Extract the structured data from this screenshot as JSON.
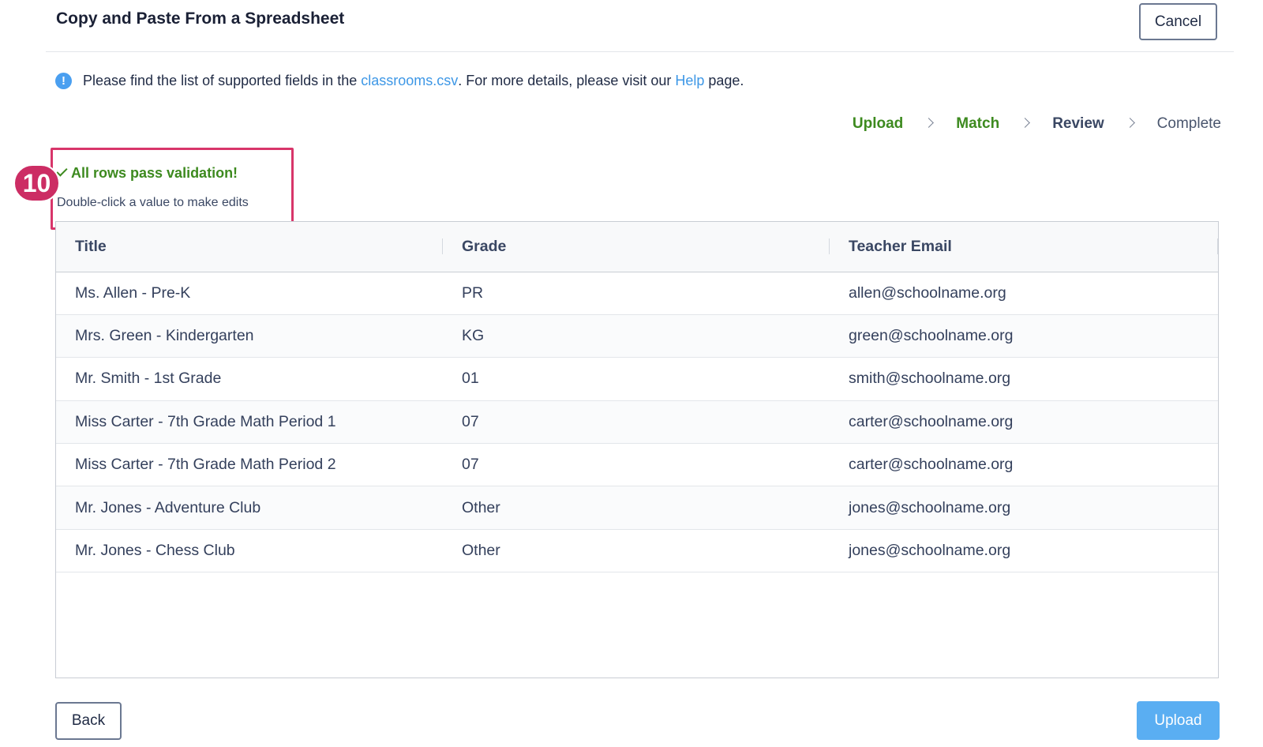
{
  "header": {
    "title": "Copy and Paste From a Spreadsheet",
    "cancel_label": "Cancel"
  },
  "info": {
    "icon": "info-icon",
    "glyph": "!",
    "text_before": "Please find the list of supported fields in the ",
    "link_file": "classrooms.csv",
    "text_middle": ". For more details, please visit our ",
    "link_help": "Help",
    "text_after": " page."
  },
  "stepper": {
    "steps": [
      {
        "label": "Upload",
        "state": "done"
      },
      {
        "label": "Match",
        "state": "done"
      },
      {
        "label": "Review",
        "state": "current"
      },
      {
        "label": "Complete",
        "state": "future"
      }
    ]
  },
  "validation": {
    "message": "All rows pass validation!",
    "hint": "Double-click a value to make edits",
    "badge": "10"
  },
  "table": {
    "columns": [
      "Title",
      "Grade",
      "Teacher Email"
    ],
    "rows": [
      [
        "Ms. Allen - Pre-K",
        "PR",
        "allen@schoolname.org"
      ],
      [
        "Mrs. Green - Kindergarten",
        "KG",
        "green@schoolname.org"
      ],
      [
        "Mr. Smith - 1st Grade",
        "01",
        "smith@schoolname.org"
      ],
      [
        "Miss Carter - 7th Grade Math Period 1",
        "07",
        "carter@schoolname.org"
      ],
      [
        "Miss Carter - 7th Grade Math Period 2",
        "07",
        "carter@schoolname.org"
      ],
      [
        "Mr. Jones - Adventure Club",
        "Other",
        "jones@schoolname.org"
      ],
      [
        "Mr. Jones - Chess Club",
        "Other",
        "jones@schoolname.org"
      ]
    ]
  },
  "footer": {
    "back_label": "Back",
    "upload_label": "Upload"
  },
  "colors": {
    "accent": "#5aaef2",
    "success": "#3d8a1f",
    "link": "#3d97e6",
    "highlight": "#d8356a"
  }
}
